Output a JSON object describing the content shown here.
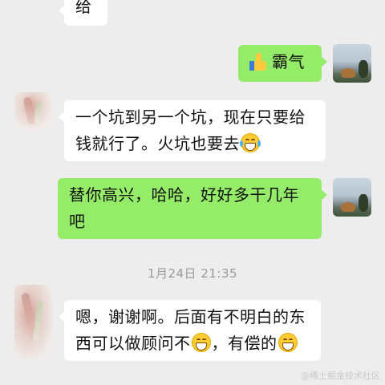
{
  "messages": [
    {
      "side": "left",
      "text": "给"
    },
    {
      "side": "right",
      "icon": "thumbs-up-icon",
      "text": "霸气"
    },
    {
      "side": "left",
      "line1": "一个坑到另一个坑，现在只要给",
      "line2": "钱就行了。火坑也要去",
      "emoji": "tears-of-joy-emoji"
    },
    {
      "side": "right",
      "line1": "替你高兴，哈哈，好好多干几年",
      "line2": "吧"
    },
    {
      "side": "left",
      "line1": "嗯，谢谢啊。后面有不明白的东",
      "line2a": "西可以做顾问不",
      "line2b": "，有偿的",
      "emoji": "grin-emoji"
    }
  ],
  "timestamp": "1月24日 21:35",
  "watermark": "@稀土掘金技术社区",
  "colors": {
    "background": "#ededed",
    "sent_bubble": "#95ec69",
    "received_bubble": "#ffffff",
    "timestamp": "#9a9a9a"
  }
}
